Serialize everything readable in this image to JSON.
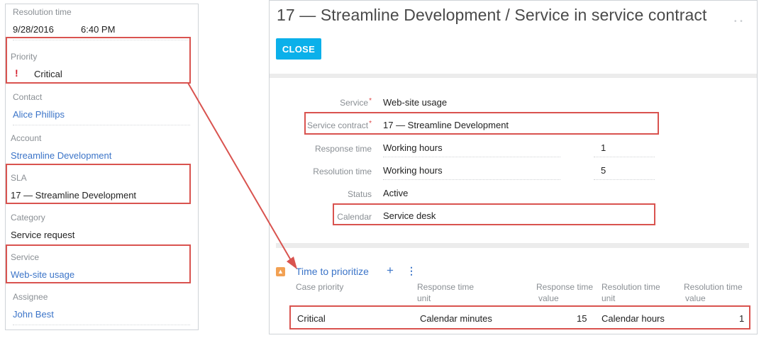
{
  "left_panel": {
    "resolution_time": {
      "label": "Resolution time",
      "date": "9/28/2016",
      "time": "6:40 PM"
    },
    "priority": {
      "label": "Priority",
      "icon": "exclamation-icon",
      "value": "Critical"
    },
    "contact": {
      "label": "Contact",
      "value": "Alice Phillips"
    },
    "account": {
      "label": "Account",
      "value": "Streamline Development"
    },
    "sla": {
      "label": "SLA",
      "value": "17 — Streamline Development"
    },
    "category": {
      "label": "Category",
      "value": "Service request"
    },
    "service": {
      "label": "Service",
      "value": "Web-site usage"
    },
    "assignee": {
      "label": "Assignee",
      "value": "John Best"
    }
  },
  "right_panel": {
    "title": "17 — Streamline Development / Service in service contract",
    "close_label": "CLOSE",
    "fields": {
      "service": {
        "label": "Service",
        "required": "*",
        "value": "Web-site usage"
      },
      "service_contract": {
        "label": "Service contract",
        "required": "*",
        "value": "17 — Streamline Development"
      },
      "response_time": {
        "label": "Response time",
        "unit": "Working hours",
        "value": "1"
      },
      "resolution_time": {
        "label": "Resolution time",
        "unit": "Working hours",
        "value": "5"
      },
      "status": {
        "label": "Status",
        "value": "Active"
      },
      "calendar": {
        "label": "Calendar",
        "value": "Service desk"
      }
    },
    "detail": {
      "title": "Time to prioritize",
      "add_icon": "plus-icon",
      "menu_icon": "vertical-dots-icon",
      "collapse_icon": "chevron-up-icon",
      "columns": [
        {
          "line1": "Case priority",
          "line2": ""
        },
        {
          "line1": "Response time",
          "line2": "unit"
        },
        {
          "line1": "Response time",
          "line2": "value"
        },
        {
          "line1": "Resolution time",
          "line2": "unit"
        },
        {
          "line1": "Resolution time",
          "line2": "value"
        }
      ],
      "rows": [
        [
          "Critical",
          "Calendar minutes",
          "15",
          "Calendar hours",
          "1"
        ]
      ]
    }
  },
  "colors": {
    "accent": "#0bb0ea",
    "link": "#3b74c8",
    "highlight": "#d9534f",
    "priority": "#d4212f",
    "collapse": "#f2a153"
  }
}
